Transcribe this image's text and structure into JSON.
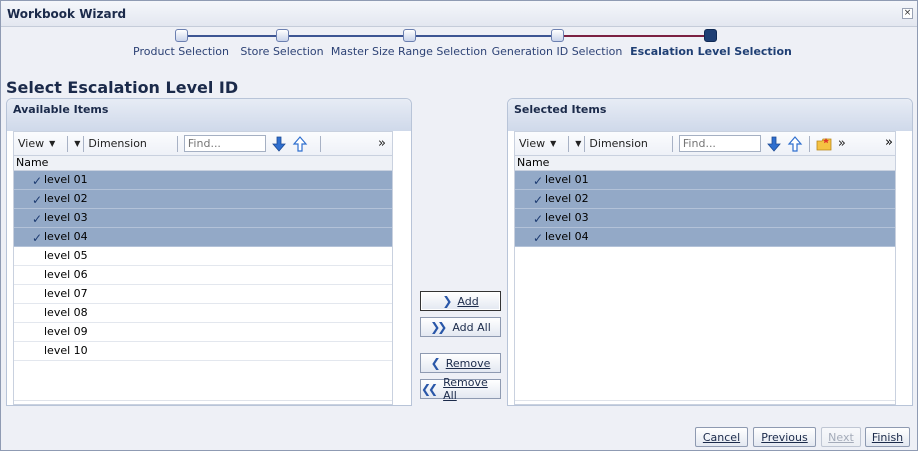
{
  "window": {
    "title": "Workbook Wizard",
    "close_glyph": "×"
  },
  "train": {
    "steps": [
      {
        "label": "Product Selection"
      },
      {
        "label": "Store Selection"
      },
      {
        "label": "Master Size Range Selection"
      },
      {
        "label": "Generation ID Selection"
      },
      {
        "label": "Escalation Level Selection"
      }
    ],
    "current_index": 4
  },
  "page_title": "Select Escalation Level ID",
  "available": {
    "header": "Available Items",
    "toolbar": {
      "view_label": "View",
      "dimension_label": "Dimension",
      "find_placeholder": "Find...",
      "overflow": "»"
    },
    "column_header": "Name",
    "rows": [
      {
        "label": "level 01",
        "selected": true
      },
      {
        "label": "level 02",
        "selected": true
      },
      {
        "label": "level 03",
        "selected": true
      },
      {
        "label": "level 04",
        "selected": true
      },
      {
        "label": "level 05",
        "selected": false
      },
      {
        "label": "level 06",
        "selected": false
      },
      {
        "label": "level 07",
        "selected": false
      },
      {
        "label": "level 08",
        "selected": false
      },
      {
        "label": "level 09",
        "selected": false
      },
      {
        "label": "level 10",
        "selected": false
      }
    ]
  },
  "selected": {
    "header": "Selected Items",
    "toolbar": {
      "view_label": "View",
      "dimension_label": "Dimension",
      "find_placeholder": "Find...",
      "overflow": "»"
    },
    "column_header": "Name",
    "rows": [
      {
        "label": "level 01",
        "selected": true
      },
      {
        "label": "level 02",
        "selected": true
      },
      {
        "label": "level 03",
        "selected": true
      },
      {
        "label": "level 04",
        "selected": true
      }
    ]
  },
  "shuttle": {
    "add_label": "Add",
    "add_all_label": "Add All",
    "remove_label": "Remove",
    "remove_all_label": "Remove All"
  },
  "footer": {
    "cancel_label": "Cancel",
    "previous_label": "Previous",
    "next_label": "Next",
    "finish_label": "Finish"
  },
  "colors": {
    "accent": "#1f3f74",
    "selection": "#93a9c7",
    "current_step": "#7b2142"
  }
}
